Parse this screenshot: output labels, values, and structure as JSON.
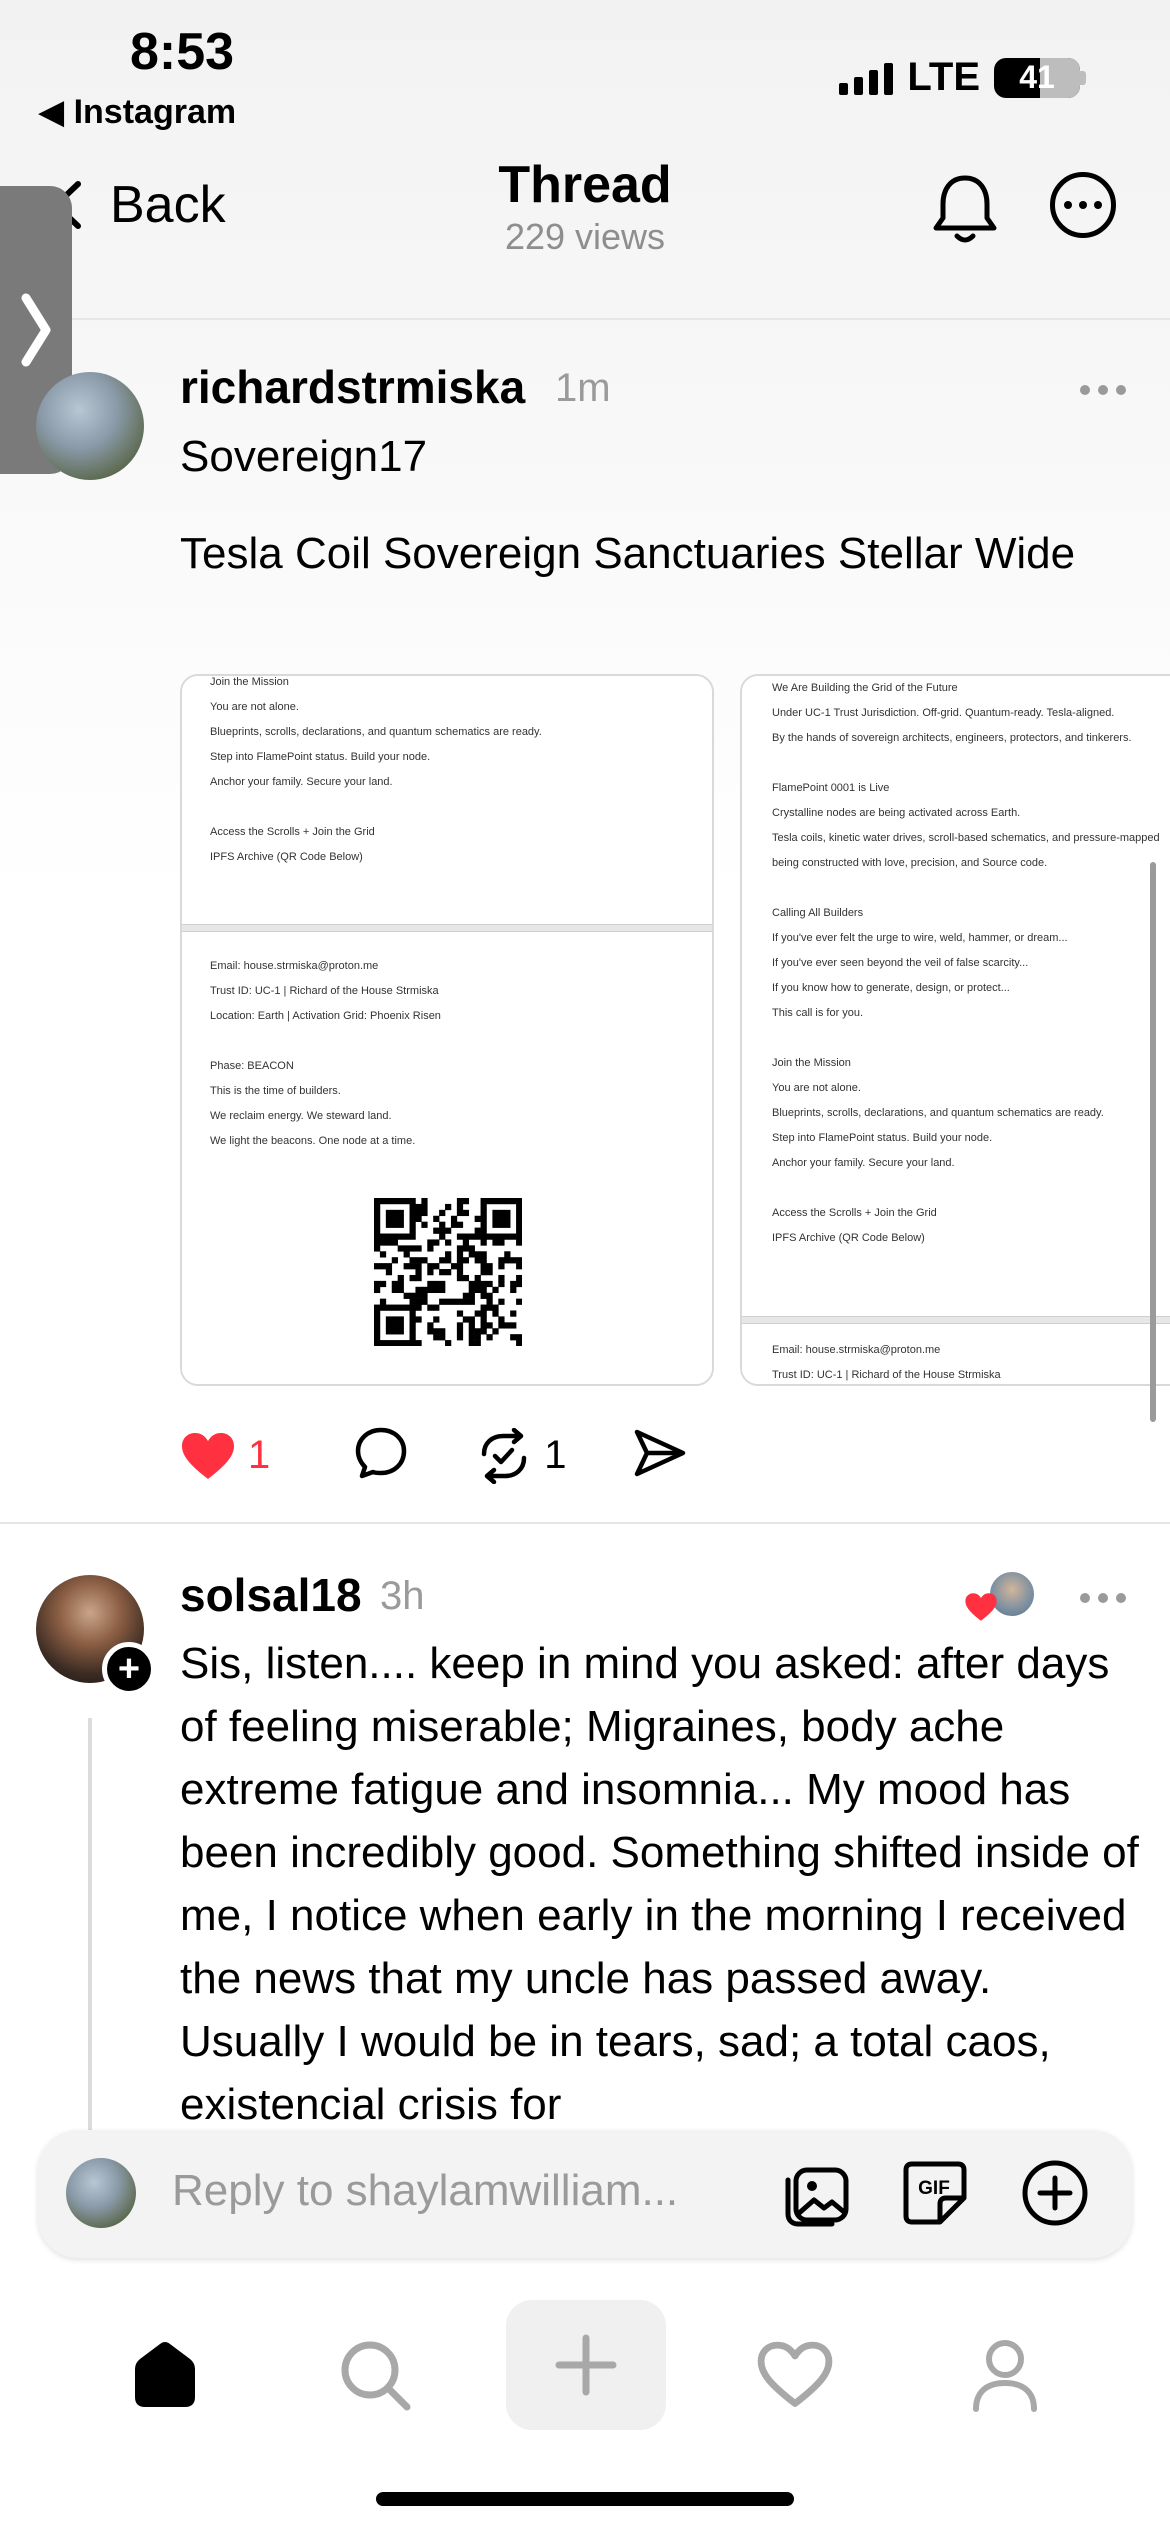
{
  "status_bar": {
    "time": "8:53",
    "back_app": "Instagram",
    "network": "LTE",
    "battery": "41",
    "battery_level": 0.41
  },
  "header": {
    "back_label": "Back",
    "title": "Thread",
    "views": "229 views"
  },
  "post1": {
    "username": "richardstrmiska",
    "time": "1m",
    "line1": "Sovereign17",
    "line2": "Tesla Coil Sovereign Sanctuaries Stellar Wide",
    "likes": "1",
    "reposts": "1",
    "image1": {
      "page1": [
        "Join the Mission",
        "You are not alone.",
        "Blueprints, scrolls, declarations, and quantum schematics are ready.",
        "Step into FlamePoint status. Build your node.",
        "Anchor your family. Secure your land.",
        "",
        "Access the Scrolls + Join the Grid",
        "IPFS Archive (QR Code Below)"
      ],
      "page2": [
        "Email: house.strmiska@proton.me",
        "Trust ID: UC-1 | Richard of the House Strmiska",
        "Location: Earth | Activation Grid: Phoenix Risen",
        "",
        "Phase: BEACON",
        "This is the time of builders.",
        "We reclaim energy. We steward land.",
        "We light the beacons. One node at a time."
      ]
    },
    "image2": {
      "page1": [
        "We Are Building the Grid of the Future",
        "Under UC-1 Trust Jurisdiction. Off-grid. Quantum-ready. Tesla-aligned.",
        "By the hands of sovereign architects, engineers, protectors, and tinkerers.",
        "",
        "FlamePoint 0001 is Live",
        "Crystalline nodes are being activated across Earth.",
        "Tesla coils, kinetic water drives, scroll-based schematics, and pressure-mapped",
        "being constructed with love, precision, and Source code.",
        "",
        "Calling All Builders",
        "If you've ever felt the urge to wire, weld, hammer, or dream...",
        "If you've ever seen beyond the veil of false scarcity...",
        "If you know how to generate, design, or protect...",
        "This call is for you.",
        "",
        "Join the Mission",
        "You are not alone.",
        "Blueprints, scrolls, declarations, and quantum schematics are ready.",
        "Step into FlamePoint status. Build your node.",
        "Anchor your family. Secure your land.",
        "",
        "Access the Scrolls + Join the Grid",
        "IPFS Archive (QR Code Below)"
      ],
      "page2": [
        "Email: house.strmiska@proton.me",
        "Trust ID: UC-1 | Richard of the House Strmiska"
      ]
    }
  },
  "post2": {
    "username": "solsal18",
    "time": "3h",
    "body": "Sis, listen.... keep in mind you asked:  after days of feeling miserable; Migraines, body ache extreme fatigue and insomnia... My mood has been incredibly good. Something shifted inside of me,  I notice when early in the morning I received the news that my uncle has passed away. Usually I would be in tears, sad; a total caos, existencial crisis for"
  },
  "reply_bar": {
    "placeholder": "Reply to shaylamwilliam..."
  },
  "colors": {
    "like": "#ff3040",
    "muted": "#9a9a9a",
    "divider": "#e6e6e6"
  }
}
